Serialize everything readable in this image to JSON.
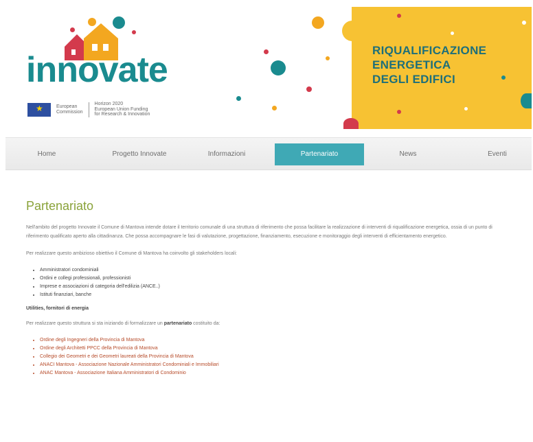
{
  "header": {
    "logo": "innovate",
    "eu_logo_text": [
      "European",
      "Commission"
    ],
    "eu_fund_text": [
      "Horizon 2020",
      "European Union Funding",
      "for Research & Innovation"
    ],
    "banner_title_lines": [
      "RIQUALIFICAZIONE",
      "ENERGETICA",
      "DEGLI EDIFICI"
    ],
    "colors": {
      "teal": "#1a8b8f",
      "yellow": "#f7c233",
      "nav_active": "#3fa9b5",
      "title_green": "#8aa33a",
      "link_red": "#b64a28"
    }
  },
  "nav": {
    "items": [
      {
        "label": "Home"
      },
      {
        "label": "Progetto Innovate"
      },
      {
        "label": "Informazioni"
      },
      {
        "label": "Partenariato",
        "active": true
      },
      {
        "label": "News"
      },
      {
        "label": "Eventi"
      }
    ]
  },
  "main": {
    "title": "Partenariato",
    "intro": "Nell'ambito del progetto Innovate il Comune di Mantova intende dotare il territorio comunale di una struttura di riferimento che possa facilitare la realizzazione di interventi di riqualificazione energetica, ossia di un punto di riferimento qualificato aperto alla cittadinanza. Che possa accompagnare le fasi di valutazione, progettazione, finanziamento, esecuzione e monitoraggio degli interventi di efficientamento energetico.",
    "stakeholders_intro": "Per realizzare questo ambizioso obiettivo il Comune di Mantova ha coinvolto gli stakeholders locali:",
    "stakeholders": [
      "Amministratori condominiali",
      "Ordini e collegi professionali, professionisti",
      "Imprese e associazioni di categoria dell'edilizia (ANCE..)",
      "Istituti finanziari, banche"
    ],
    "utilities": "Utilities, fornitori di energia",
    "partnership_intro_before": "Per realizzare questo struttura si sta iniziando di formalizzare un ",
    "partnership_intro_bold": "partenariato",
    "partnership_intro_after": " costituito da:",
    "partners": [
      "Ordine degli Ingegneri della Provincia di Mantova",
      "Ordine degli Architetti PPCC della Provincia di Mantova",
      "Collegio dei Geometri e dei Geometri laureati della Provincia di Mantova",
      "ANACI Mantova - Associazione Nazionale Amministratori Condominiali e Immobiliari",
      "ANAC Mantova - Associazione Italiana Amministratori di Condominio"
    ]
  }
}
